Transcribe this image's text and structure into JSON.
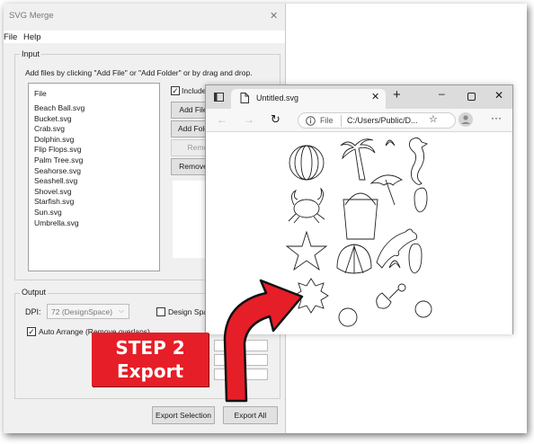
{
  "merge_window": {
    "title": "SVG Merge",
    "close_icon": "close-icon",
    "menu": [
      "File",
      "Help"
    ]
  },
  "input": {
    "group_label": "Input",
    "hint": "Add files by clicking \"Add File\" or \"Add Folder\" or by drag and drop.",
    "list_header": "File",
    "files": [
      "Beach Ball.svg",
      "Bucket.svg",
      "Crab.svg",
      "Dolphin.svg",
      "Flip Flops.svg",
      "Palm Tree.svg",
      "Seahorse.svg",
      "Seashell.svg",
      "Shovel.svg",
      "Starfish.svg",
      "Sun.svg",
      "Umbrella.svg"
    ],
    "include_label": "Include s",
    "include_checked": true,
    "add_file": "Add File",
    "add_folder": "Add Fold",
    "remove": "Remov",
    "remove_all": "Remove"
  },
  "output": {
    "group_label": "Output",
    "dpi_label": "DPI:",
    "dpi_value": "72 (DesignSpace)",
    "design_space_label": "Design Space",
    "design_space_checked": false,
    "auto_arrange_label": "Auto Arrange (Remove overlaps)",
    "auto_arrange_checked": true,
    "export_selection": "Export Selection",
    "export_all": "Export All"
  },
  "browser": {
    "tab_title": "Untitled.svg",
    "new_tab_icon": "plus-icon",
    "minimize_icon": "minimize-icon",
    "maximize_icon": "maximize-icon",
    "close_icon": "close-icon",
    "address_prefix": "File",
    "address_url": "C:/Users/Public/D...",
    "svg_shapes": [
      "beach-ball",
      "palm-tree",
      "seahorse",
      "umbrella",
      "crab",
      "bucket",
      "flip-flop",
      "starfish",
      "dolphin",
      "seashell",
      "sun",
      "shovel",
      "circle"
    ]
  },
  "callout": {
    "line1": "STEP 2",
    "line2": "Export",
    "color": "#e61e28"
  }
}
